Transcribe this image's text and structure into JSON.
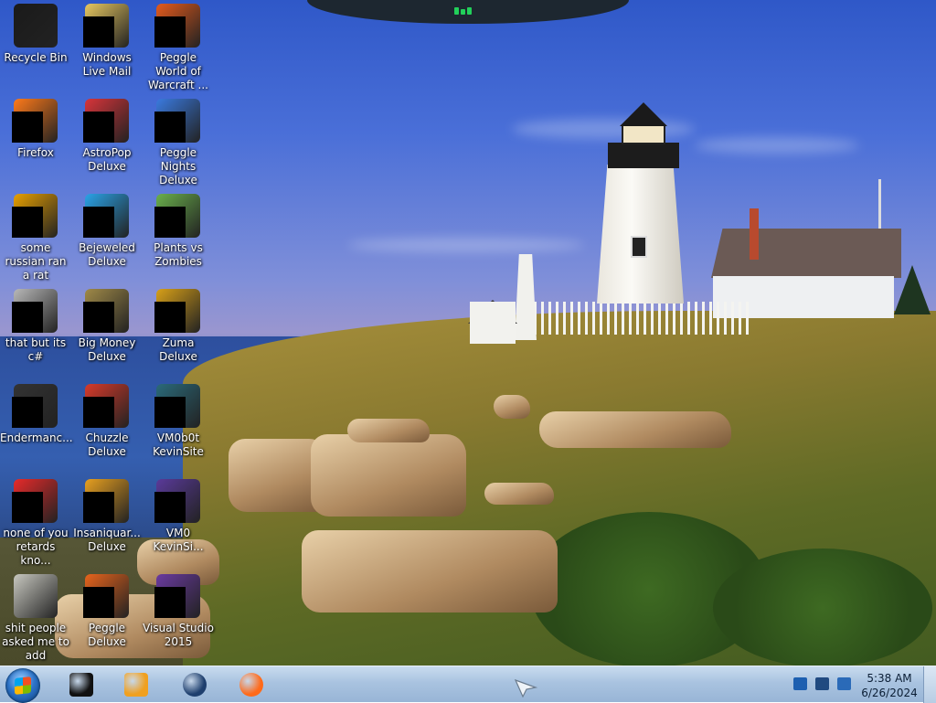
{
  "desktop": {
    "icons": [
      {
        "label": "Recycle Bin",
        "icon": "recycle-bin-icon",
        "masked": false,
        "color": "#1a1a1a"
      },
      {
        "label": "Windows Live Mail",
        "icon": "mail-icon",
        "masked": true,
        "color": "#e8c860"
      },
      {
        "label": "Peggle World of Warcraft ...",
        "icon": "peggle-wow-icon",
        "masked": true,
        "color": "#e45a1c"
      },
      {
        "label": "Firefox",
        "icon": "firefox-icon",
        "masked": true,
        "color": "#ff7a1a"
      },
      {
        "label": "AstroPop Deluxe",
        "icon": "astropop-icon",
        "masked": true,
        "color": "#d8343a"
      },
      {
        "label": "Peggle Nights Deluxe",
        "icon": "peggle-nights-icon",
        "masked": true,
        "color": "#3a7ae0"
      },
      {
        "label": "some russian ran a rat",
        "icon": "app-icon",
        "masked": true,
        "color": "#e8a000"
      },
      {
        "label": "Bejeweled Deluxe",
        "icon": "bejeweled-icon",
        "masked": true,
        "color": "#2aa3e8"
      },
      {
        "label": "Plants vs Zombies",
        "icon": "pvz-icon",
        "masked": true,
        "color": "#6ab04c"
      },
      {
        "label": "that but its c#",
        "icon": "file-stack-icon",
        "masked": true,
        "color": "#b8b8b8"
      },
      {
        "label": "Big Money Deluxe",
        "icon": "money-bag-icon",
        "masked": true,
        "color": "#a08a48"
      },
      {
        "label": "Zuma Deluxe",
        "icon": "zuma-icon",
        "masked": true,
        "color": "#d8a018"
      },
      {
        "label": "Endermanc...",
        "icon": "terminal-icon",
        "masked": true,
        "color": "#333333"
      },
      {
        "label": "Chuzzle Deluxe",
        "icon": "chuzzle-icon",
        "masked": true,
        "color": "#d83a2a"
      },
      {
        "label": "VM0b0t KevinSite",
        "icon": "vm-icon",
        "masked": true,
        "color": "#2a6a7a"
      },
      {
        "label": "none of you retards kno...",
        "icon": "opera-icon",
        "masked": true,
        "color": "#e82a2a"
      },
      {
        "label": "Insaniquar... Deluxe",
        "icon": "insaniquarium-icon",
        "masked": true,
        "color": "#e8a020"
      },
      {
        "label": "VM0 KevinSi...",
        "icon": "vm-icon",
        "masked": true,
        "color": "#5a3a9a"
      },
      {
        "label": "shit people asked me to add",
        "icon": "folder-icon",
        "masked": false,
        "color": "#c8c8c0"
      },
      {
        "label": "Peggle Deluxe",
        "icon": "peggle-icon",
        "masked": true,
        "color": "#e8641c"
      },
      {
        "label": "Visual Studio 2015",
        "icon": "visual-studio-icon",
        "masked": true,
        "color": "#6a3aa0"
      }
    ]
  },
  "taskbar": {
    "start_label": "Start",
    "pinned": [
      {
        "name": "cmd-icon",
        "color": "#111111"
      },
      {
        "name": "media-player-icon",
        "color": "#f0a020"
      },
      {
        "name": "globe-icon",
        "color": "#1e3f6e"
      },
      {
        "name": "firefox-icon",
        "color": "#ff6a1a"
      }
    ],
    "tray": [
      {
        "name": "network-icon",
        "color": "#1d5fb0"
      },
      {
        "name": "display-icon",
        "color": "#204a80"
      },
      {
        "name": "sound-icon",
        "color": "#2a6ab8"
      }
    ],
    "clock": {
      "time": "5:38 AM",
      "date": "6/26/2024"
    }
  }
}
